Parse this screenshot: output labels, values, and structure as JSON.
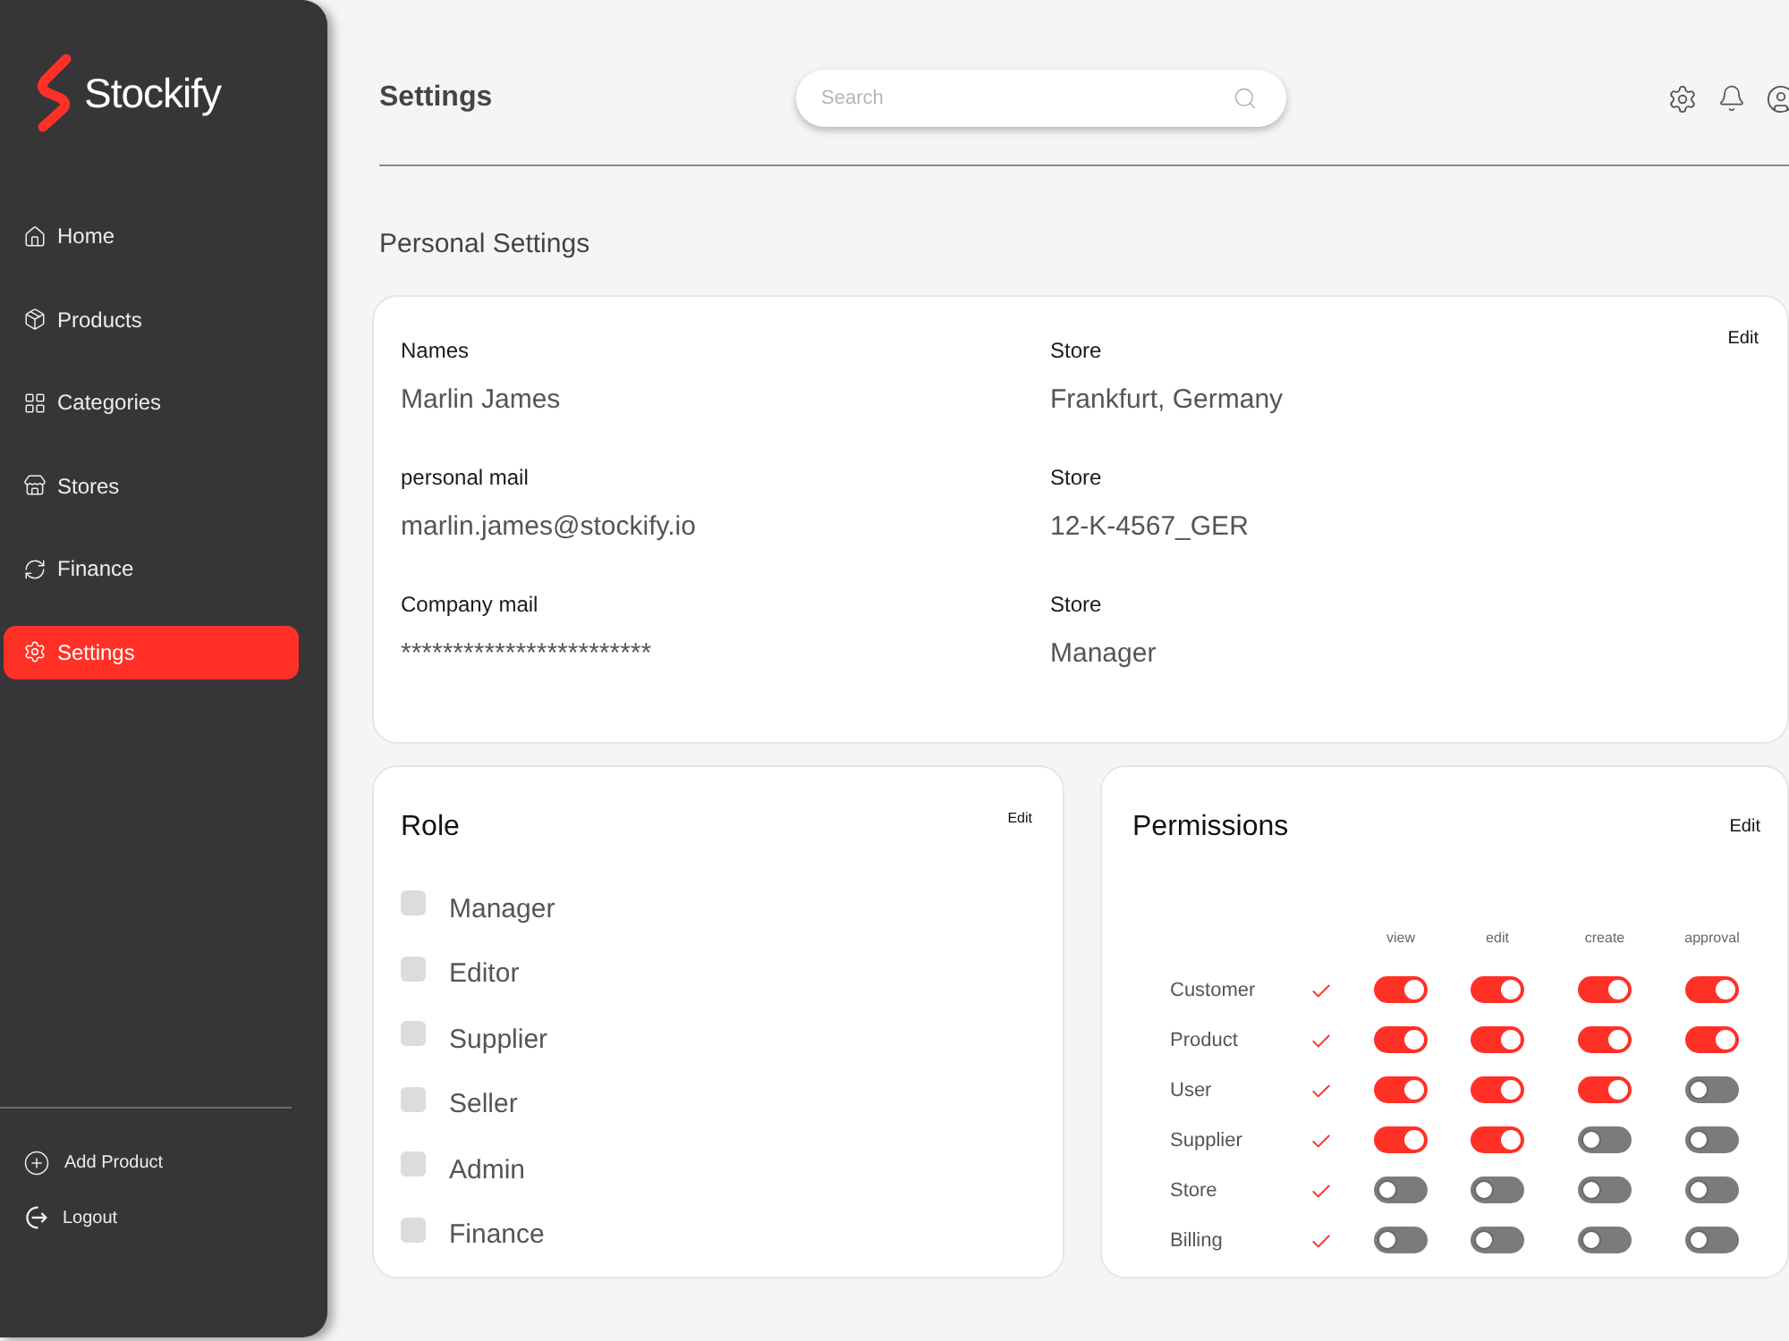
{
  "sidebar": {
    "brand": "Stockify",
    "items": [
      {
        "label": "Home",
        "selected": false
      },
      {
        "label": "Products",
        "selected": false
      },
      {
        "label": "Categories",
        "selected": false
      },
      {
        "label": "Stores",
        "selected": false
      },
      {
        "label": "Finance",
        "selected": false
      },
      {
        "label": "Settings",
        "selected": true
      }
    ],
    "footer_items": [
      {
        "label": "Add Product"
      },
      {
        "label": "Logout"
      }
    ]
  },
  "header": {
    "title": "Settings",
    "search": {
      "placeholder": "Search"
    }
  },
  "section_title": "Personal Settings",
  "personal_card": {
    "edit": "Edit",
    "fields": [
      {
        "label": "Names",
        "value": "Marlin James"
      },
      {
        "label": "Store",
        "value": "Frankfurt, Germany"
      },
      {
        "label": "personal mail",
        "value": "marlin.james@stockify.io"
      },
      {
        "label": "Store",
        "value": "12-K-4567_GER"
      },
      {
        "label": "Company mail",
        "value": "************************"
      },
      {
        "label": "Store",
        "value": "Manager"
      }
    ]
  },
  "role_card": {
    "title": "Role",
    "edit": "Edit",
    "roles": [
      {
        "label": "Manager",
        "checked": false
      },
      {
        "label": "Editor",
        "checked": false
      },
      {
        "label": "Supplier",
        "checked": false
      },
      {
        "label": "Seller",
        "checked": false
      },
      {
        "label": "Admin",
        "checked": false
      },
      {
        "label": "Finance",
        "checked": false
      }
    ]
  },
  "permissions_card": {
    "title": "Permissions",
    "edit": "Edit",
    "columns": [
      "view",
      "edit",
      "create",
      "approval"
    ],
    "rows": [
      {
        "label": "Customer",
        "checked": true,
        "toggles": [
          {
            "on": true
          },
          {
            "on": true
          },
          {
            "on": true
          },
          {
            "on": true
          }
        ]
      },
      {
        "label": "Product",
        "checked": true,
        "toggles": [
          {
            "on": true
          },
          {
            "on": true
          },
          {
            "on": true
          },
          {
            "on": true
          }
        ]
      },
      {
        "label": "User",
        "checked": true,
        "toggles": [
          {
            "on": true
          },
          {
            "on": true
          },
          {
            "on": true
          },
          {
            "on": false
          }
        ]
      },
      {
        "label": "Supplier",
        "checked": true,
        "toggles": [
          {
            "on": true
          },
          {
            "on": true
          },
          {
            "on": false
          },
          {
            "on": false
          }
        ]
      },
      {
        "label": "Store",
        "checked": true,
        "toggles": [
          {
            "on": false
          },
          {
            "on": false
          },
          {
            "on": false
          },
          {
            "on": false
          }
        ]
      },
      {
        "label": "Billing",
        "checked": true,
        "toggles": [
          {
            "on": false
          },
          {
            "on": false
          },
          {
            "on": false
          },
          {
            "on": false
          }
        ]
      }
    ]
  }
}
